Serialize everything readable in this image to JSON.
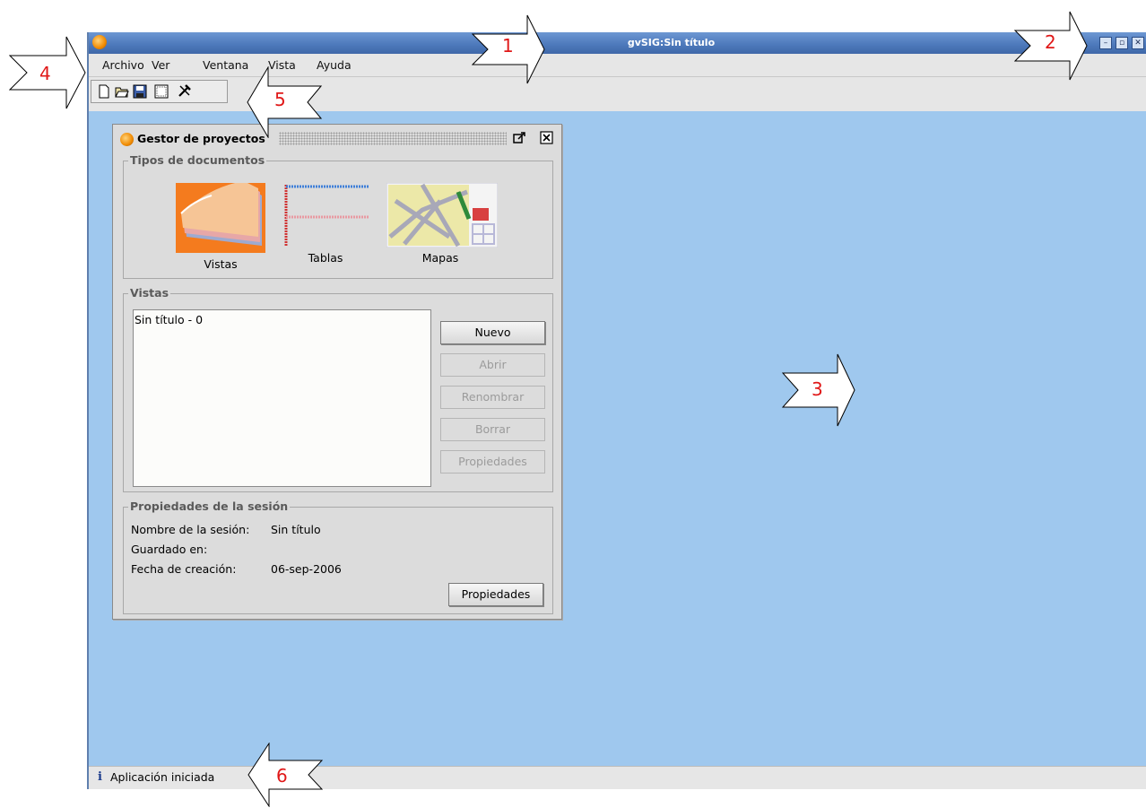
{
  "window": {
    "title": "gvSIG:Sin título",
    "controls": [
      "–",
      "▫",
      "✕"
    ]
  },
  "menubar": [
    "Archivo",
    "Ver",
    "Ventana",
    "Vista",
    "Ayuda"
  ],
  "toolbar": {
    "icons": [
      "new-document-icon",
      "open-folder-icon",
      "save-disk-icon",
      "select-icon",
      "tools-icon"
    ]
  },
  "project_manager": {
    "title": "Gestor de proyectos",
    "doc_types": {
      "title": "Tipos de documentos",
      "items": [
        "Vistas",
        "Tablas",
        "Mapas"
      ]
    },
    "list": {
      "title": "Vistas",
      "items": [
        "Sin título - 0"
      ]
    },
    "buttons": [
      "Nuevo",
      "Abrir",
      "Renombrar",
      "Borrar",
      "Propiedades"
    ],
    "session": {
      "title": "Propiedades de la sesión",
      "name_label": "Nombre de la sesión:",
      "name_value": "Sin título",
      "saved_label": "Guardado en:",
      "saved_value": "",
      "created_label": "Fecha de creación:",
      "created_value": "06-sep-2006",
      "properties_button": "Propiedades"
    }
  },
  "statusbar": {
    "text": "Aplicación iniciada"
  },
  "callouts": [
    "1",
    "2",
    "3",
    "4",
    "5",
    "6"
  ],
  "colors": {
    "desktop": "#9fc8ee",
    "titlebar": "#4c78ba",
    "callout_text": "#e01818"
  }
}
